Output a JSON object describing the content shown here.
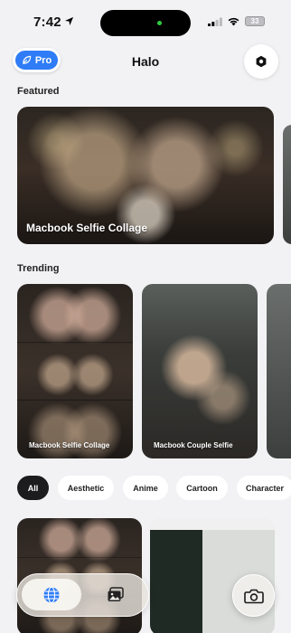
{
  "status_bar": {
    "time": "7:42",
    "battery": "33"
  },
  "header": {
    "title": "Halo",
    "pro_label": "Pro"
  },
  "sections": {
    "featured": "Featured",
    "trending": "Trending"
  },
  "featured": [
    {
      "label": "Macbook Selfie Collage"
    }
  ],
  "trending": [
    {
      "label": "Macbook Selfie Collage"
    },
    {
      "label": "Macbook Couple Selfie"
    }
  ],
  "filters": [
    "All",
    "Aesthetic",
    "Anime",
    "Cartoon",
    "Character"
  ],
  "colors": {
    "accent": "#2f7cf6",
    "chip_active": "#1c1c1e",
    "background": "#f2f2f4"
  },
  "icons": {
    "pro": "leaf-icon",
    "settings": "hexagon-settings-icon",
    "tab_explore": "globe-icon",
    "tab_gallery": "gallery-icon",
    "camera": "camera-icon"
  }
}
